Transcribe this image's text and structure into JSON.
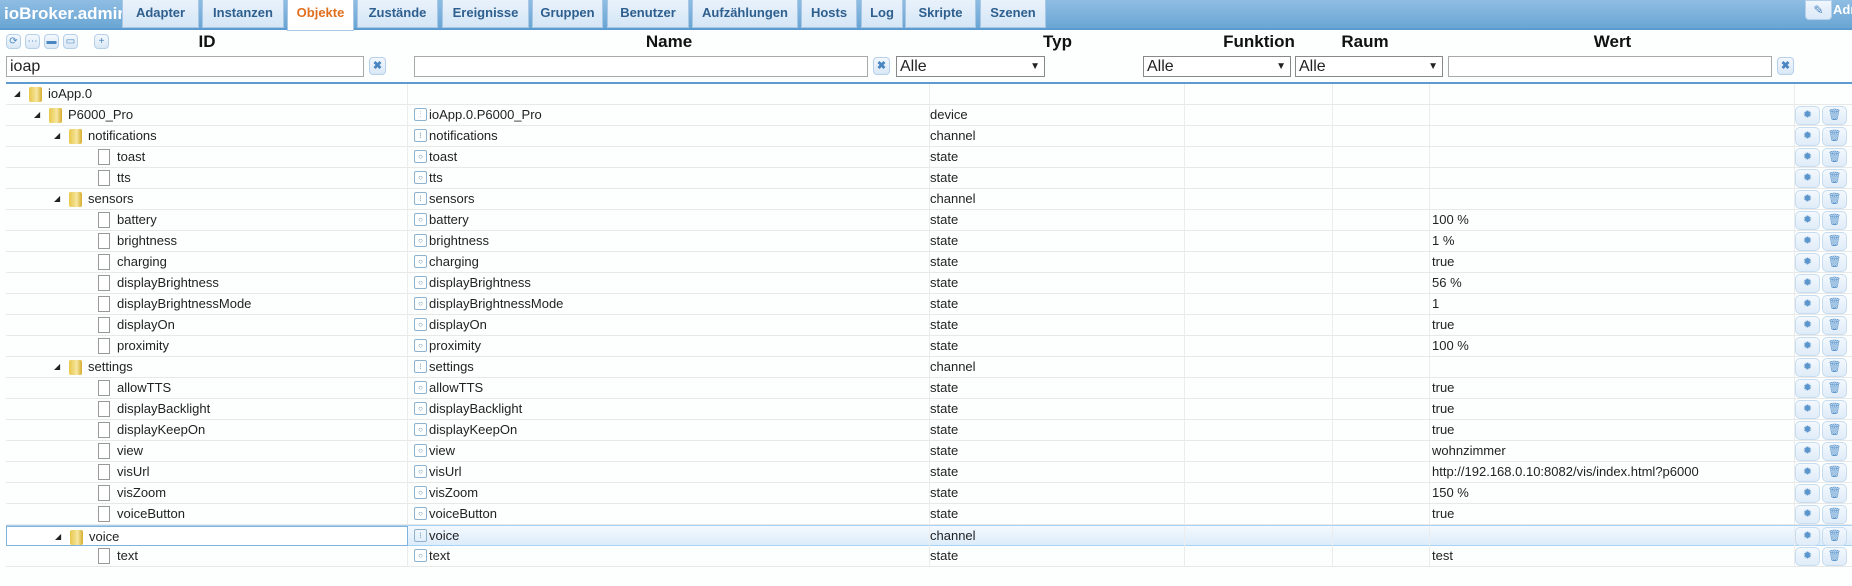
{
  "app_title": "ioBroker.admin",
  "user_label": "Admin",
  "tabs": [
    {
      "label": "Adapter"
    },
    {
      "label": "Instanzen"
    },
    {
      "label": "Objekte",
      "active": true
    },
    {
      "label": "Zustände"
    },
    {
      "label": "Ereignisse"
    },
    {
      "label": "Gruppen"
    },
    {
      "label": "Benutzer"
    },
    {
      "label": "Aufzählungen"
    },
    {
      "label": "Hosts"
    },
    {
      "label": "Log"
    },
    {
      "label": "Skripte"
    },
    {
      "label": "Szenen"
    }
  ],
  "columns": {
    "id": "ID",
    "name": "Name",
    "typ": "Typ",
    "funktion": "Funktion",
    "raum": "Raum",
    "wert": "Wert"
  },
  "filters": {
    "id": "ioap",
    "name": "",
    "typ": "Alle",
    "funktion": "Alle",
    "raum": "Alle",
    "wert": ""
  },
  "rows": [
    {
      "id": "ioApp.0",
      "level": 0,
      "kind": "folder",
      "name": "",
      "icon": "",
      "type": "",
      "value": "",
      "buttons": false
    },
    {
      "id": "P6000_Pro",
      "level": 1,
      "kind": "folder",
      "name": "ioApp.0.P6000_Pro",
      "icon": "device",
      "type": "device",
      "value": "",
      "buttons": true
    },
    {
      "id": "notifications",
      "level": 2,
      "kind": "folder",
      "name": "notifications",
      "icon": "channel",
      "type": "channel",
      "value": "",
      "buttons": true
    },
    {
      "id": "toast",
      "level": 3,
      "kind": "leaf",
      "name": "toast",
      "icon": "state",
      "type": "state",
      "value": "",
      "buttons": true
    },
    {
      "id": "tts",
      "level": 3,
      "kind": "leaf",
      "name": "tts",
      "icon": "state",
      "type": "state",
      "value": "",
      "buttons": true
    },
    {
      "id": "sensors",
      "level": 2,
      "kind": "folder",
      "name": "sensors",
      "icon": "channel",
      "type": "channel",
      "value": "",
      "buttons": true
    },
    {
      "id": "battery",
      "level": 3,
      "kind": "leaf",
      "name": "battery",
      "icon": "state",
      "type": "state",
      "value": "100 %",
      "buttons": true
    },
    {
      "id": "brightness",
      "level": 3,
      "kind": "leaf",
      "name": "brightness",
      "icon": "state",
      "type": "state",
      "value": "1 %",
      "buttons": true
    },
    {
      "id": "charging",
      "level": 3,
      "kind": "leaf",
      "name": "charging",
      "icon": "state",
      "type": "state",
      "value": "true",
      "buttons": true
    },
    {
      "id": "displayBrightness",
      "level": 3,
      "kind": "leaf",
      "name": "displayBrightness",
      "icon": "state",
      "type": "state",
      "value": "56 %",
      "buttons": true
    },
    {
      "id": "displayBrightnessMode",
      "level": 3,
      "kind": "leaf",
      "name": "displayBrightnessMode",
      "icon": "state",
      "type": "state",
      "value": "1",
      "buttons": true
    },
    {
      "id": "displayOn",
      "level": 3,
      "kind": "leaf",
      "name": "displayOn",
      "icon": "state",
      "type": "state",
      "value": "true",
      "buttons": true
    },
    {
      "id": "proximity",
      "level": 3,
      "kind": "leaf",
      "name": "proximity",
      "icon": "state",
      "type": "state",
      "value": "100 %",
      "buttons": true
    },
    {
      "id": "settings",
      "level": 2,
      "kind": "folder",
      "name": "settings",
      "icon": "channel",
      "type": "channel",
      "value": "",
      "buttons": true
    },
    {
      "id": "allowTTS",
      "level": 3,
      "kind": "leaf",
      "name": "allowTTS",
      "icon": "state",
      "type": "state",
      "value": "true",
      "buttons": true
    },
    {
      "id": "displayBacklight",
      "level": 3,
      "kind": "leaf",
      "name": "displayBacklight",
      "icon": "state",
      "type": "state",
      "value": "true",
      "buttons": true
    },
    {
      "id": "displayKeepOn",
      "level": 3,
      "kind": "leaf",
      "name": "displayKeepOn",
      "icon": "state",
      "type": "state",
      "value": "true",
      "buttons": true
    },
    {
      "id": "view",
      "level": 3,
      "kind": "leaf",
      "name": "view",
      "icon": "state",
      "type": "state",
      "value": "wohnzimmer",
      "buttons": true
    },
    {
      "id": "visUrl",
      "level": 3,
      "kind": "leaf",
      "name": "visUrl",
      "icon": "state",
      "type": "state",
      "value": "http://192.168.0.10:8082/vis/index.html?p6000",
      "buttons": true
    },
    {
      "id": "visZoom",
      "level": 3,
      "kind": "leaf",
      "name": "visZoom",
      "icon": "state",
      "type": "state",
      "value": "150 %",
      "buttons": true
    },
    {
      "id": "voiceButton",
      "level": 3,
      "kind": "leaf",
      "name": "voiceButton",
      "icon": "state",
      "type": "state",
      "value": "true",
      "buttons": true
    },
    {
      "id": "voice",
      "level": 2,
      "kind": "folder",
      "name": "voice",
      "icon": "channel",
      "type": "channel",
      "value": "",
      "buttons": true,
      "selected": true
    },
    {
      "id": "text",
      "level": 3,
      "kind": "leaf",
      "name": "text",
      "icon": "state",
      "type": "state",
      "value": "test",
      "buttons": true
    }
  ],
  "colors": {
    "accent": "#5b9bd0",
    "active_tab": "#e16f1e"
  }
}
